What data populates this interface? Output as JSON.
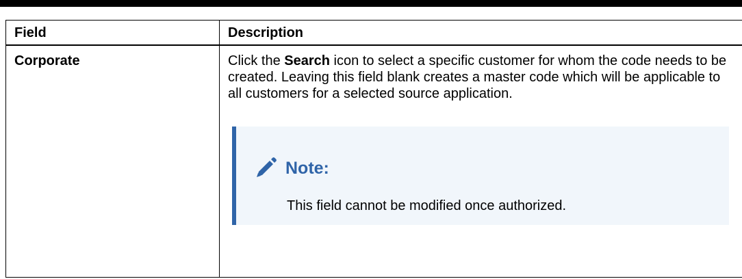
{
  "table": {
    "headers": {
      "field": "Field",
      "description": "Description"
    },
    "rows": [
      {
        "field": "Corporate",
        "description": {
          "part1": "Click the ",
          "bold": "Search",
          "part2": " icon to select a specific customer for whom the code needs to be created. Leaving this field blank creates a master code which will be applicable to all customers for a selected source application."
        },
        "note": {
          "icon": "pencil-icon",
          "title": "Note:",
          "text": "This field cannot be modified once authorized."
        }
      }
    ]
  },
  "colors": {
    "note_accent": "#2f64a8",
    "note_background": "#f1f6fb"
  }
}
